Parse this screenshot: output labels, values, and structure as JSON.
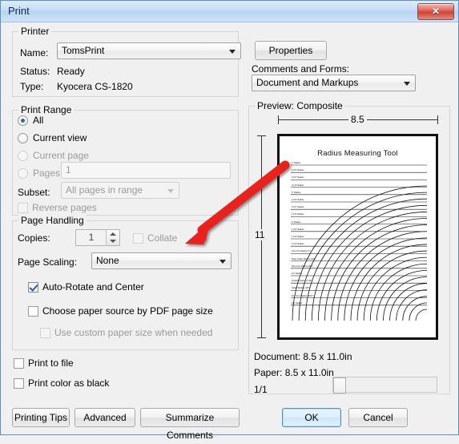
{
  "window": {
    "title": "Print",
    "close_label": "✕"
  },
  "printer": {
    "group_label": "Printer",
    "name_label": "Name:",
    "name_value": "TomsPrint",
    "status_label": "Status:",
    "status_value": "Ready",
    "type_label": "Type:",
    "type_value": "Kyocera CS-1820",
    "properties_button": "Properties",
    "comments_forms_label": "Comments and Forms:",
    "comments_forms_value": "Document and Markups"
  },
  "print_range": {
    "group_label": "Print Range",
    "options": [
      {
        "label": "All",
        "selected": true,
        "enabled": true
      },
      {
        "label": "Current view",
        "selected": false,
        "enabled": true
      },
      {
        "label": "Current page",
        "selected": false,
        "enabled": false
      },
      {
        "label": "Pages",
        "selected": false,
        "enabled": false
      }
    ],
    "pages_value": "1",
    "subset_label": "Subset:",
    "subset_value": "All pages in range",
    "reverse_pages_label": "Reverse pages",
    "reverse_pages_checked": false
  },
  "page_handling": {
    "group_label": "Page Handling",
    "copies_label": "Copies:",
    "copies_value": "1",
    "collate_label": "Collate",
    "collate_checked": false,
    "page_scaling_label": "Page Scaling:",
    "page_scaling_value": "None",
    "auto_rotate_label": "Auto-Rotate and Center",
    "auto_rotate_checked": true,
    "choose_paper_label": "Choose paper source by PDF page size",
    "choose_paper_checked": false,
    "custom_paper_label": "Use custom paper size when needed",
    "custom_paper_checked": false
  },
  "extra_options": {
    "print_to_file_label": "Print to file",
    "print_to_file_checked": false,
    "print_color_as_black_label": "Print color as black",
    "print_color_as_black_checked": false
  },
  "bottom_buttons": {
    "printing_tips": "Printing Tips",
    "advanced": "Advanced",
    "summarize_comments": "Summarize Comments",
    "ok": "OK",
    "cancel": "Cancel"
  },
  "preview": {
    "group_label": "Preview: Composite",
    "width_ruler": "8.5",
    "height_ruler": "11",
    "document_info": "Document: 8.5 x 11.0in",
    "paper_info": "Paper: 8.5 x 11.0in",
    "page_counter": "1/1",
    "document": {
      "title": "Radius Measuring Tool",
      "labels": [
        "4\" Radius",
        "3 3/4\" Radius",
        "3 1/2\" Radius",
        "3 1/4\" Radius",
        "3\" Radius",
        "2 3/4\" Radius",
        "2 1/2\" Radius",
        "2 1/4\" Radius",
        "2\" Radius",
        "1 3/4\" Radius",
        "1 1/2\" Radius",
        "1 1/4\" Radius",
        "One Inch Radius (1\")",
        "Silver Dollar Radius (3/4\")",
        "Fifty Cent Radius (5/8\")",
        "1/2\" Radius",
        "Quarter Radius (7/16\")",
        "Nickel Radius (3/8\")",
        "Ten Cent Radius (5/16\")",
        "1/4\" Radius"
      ]
    }
  },
  "annotation": {
    "arrow_color": "#e8201a",
    "arrow_name": "red-pointer-arrow"
  }
}
